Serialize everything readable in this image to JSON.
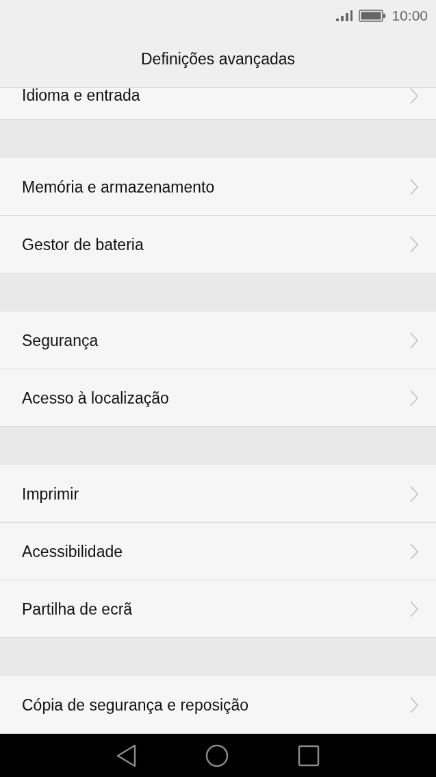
{
  "status_bar": {
    "time": "10:00"
  },
  "title": "Definições avançadas",
  "groups": [
    {
      "items": [
        {
          "label": "Idioma e entrada",
          "cut_off": true
        }
      ]
    },
    {
      "items": [
        {
          "label": "Memória e armazenamento",
          "cut_off": false
        },
        {
          "label": "Gestor de bateria",
          "cut_off": false
        }
      ]
    },
    {
      "items": [
        {
          "label": "Segurança",
          "cut_off": false
        },
        {
          "label": "Acesso à localização",
          "cut_off": false
        }
      ]
    },
    {
      "items": [
        {
          "label": "Imprimir",
          "cut_off": false
        },
        {
          "label": "Acessibilidade",
          "cut_off": false
        },
        {
          "label": "Partilha de ecrã",
          "cut_off": false
        }
      ]
    },
    {
      "items": [
        {
          "label": "Cópia de segurança e reposição",
          "cut_off": false
        }
      ]
    }
  ]
}
